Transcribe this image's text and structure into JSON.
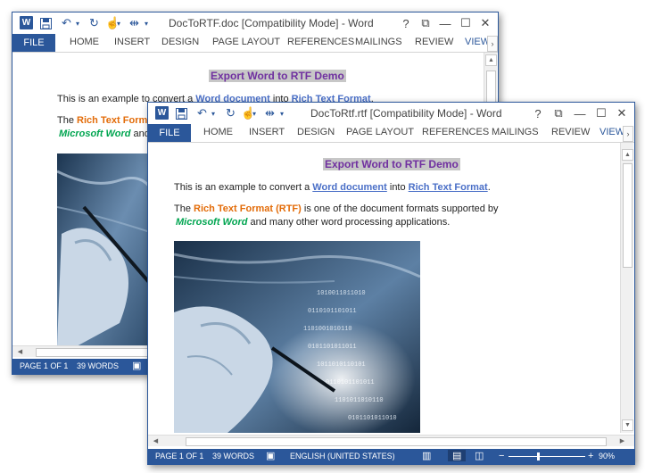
{
  "window_back": {
    "title": "DocToRTF.doc [Compatibility Mode] - Word",
    "file_tab": "FILE",
    "tabs": [
      "HOME",
      "INSERT",
      "DESIGN",
      "PAGE LAYOUT",
      "REFERENCES",
      "MAILINGS",
      "REVIEW"
    ],
    "view_tab": "VIEW",
    "heading": "Export Word to RTF Demo",
    "para1_prefix": "This is an example to convert a ",
    "para1_link1": "Word document",
    "para1_mid": " into ",
    "para1_link2": "Rich Text Format",
    "para1_suffix": ".",
    "para2_prefix": "The ",
    "para2_orange": "Rich Text Format",
    "para2_line2_green": "Microsoft Word",
    "para2_line2_rest": " and m",
    "status": {
      "page": "PAGE 1 OF 1",
      "words": "39 WORDS"
    },
    "controls": {
      "help": "?",
      "restore": "⧉",
      "minimize": "—",
      "maximize": "☐",
      "close": "✕"
    }
  },
  "window_front": {
    "title": "DocToRtf.rtf [Compatibility Mode] - Word",
    "file_tab": "FILE",
    "tabs": [
      "HOME",
      "INSERT",
      "DESIGN",
      "PAGE LAYOUT",
      "REFERENCES",
      "MAILINGS",
      "REVIEW"
    ],
    "view_tab": "VIEW",
    "heading": "Export Word to RTF Demo",
    "para1_prefix": "This is an example to convert a ",
    "para1_link1": "Word document",
    "para1_mid": " into ",
    "para1_link2": "Rich Text Format",
    "para1_suffix": ".",
    "para2_prefix": "The ",
    "para2_orange": "Rich Text Format (RTF)",
    "para2_rest": " is one of the document formats supported by",
    "para2_line2_green": "Microsoft Word",
    "para2_line2_rest": " and many other word processing applications.",
    "status": {
      "page": "PAGE 1 OF 1",
      "words": "39 WORDS",
      "language": "ENGLISH (UNITED STATES)",
      "zoom": "90%",
      "minus": "−",
      "plus": "+"
    },
    "zoom_level": 0.9,
    "controls": {
      "help": "?",
      "restore": "⧉",
      "minimize": "—",
      "maximize": "☐",
      "close": "✕"
    }
  },
  "colors": {
    "accent": "#2b579a",
    "heading": "#7030a0",
    "link": "#4a6fc7",
    "orange": "#e36c09",
    "green": "#00a550"
  },
  "icons": [
    "word-icon",
    "save-icon",
    "undo-icon",
    "redo-icon",
    "touch-mode-icon",
    "customize-icon"
  ]
}
